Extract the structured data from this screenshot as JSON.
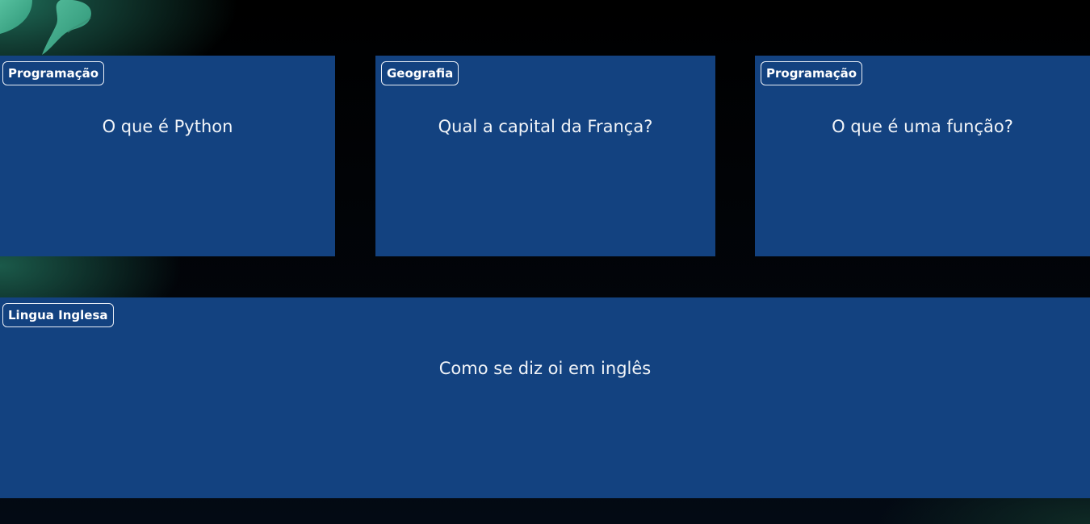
{
  "colors": {
    "background": "#000000",
    "card": "#134280",
    "text": "#f1f4f8",
    "accent_teal": "#3cb391"
  },
  "decoration": {
    "icon": "teal-swoosh-decoration-icon"
  },
  "cards": [
    {
      "category": "Programação",
      "question": "O que é Python"
    },
    {
      "category": "Geografia",
      "question": "Qual a capital da França?"
    },
    {
      "category": "Programação",
      "question": "O que é uma função?"
    },
    {
      "category": "Lingua Inglesa",
      "question": "Como se diz oi em inglês"
    }
  ]
}
